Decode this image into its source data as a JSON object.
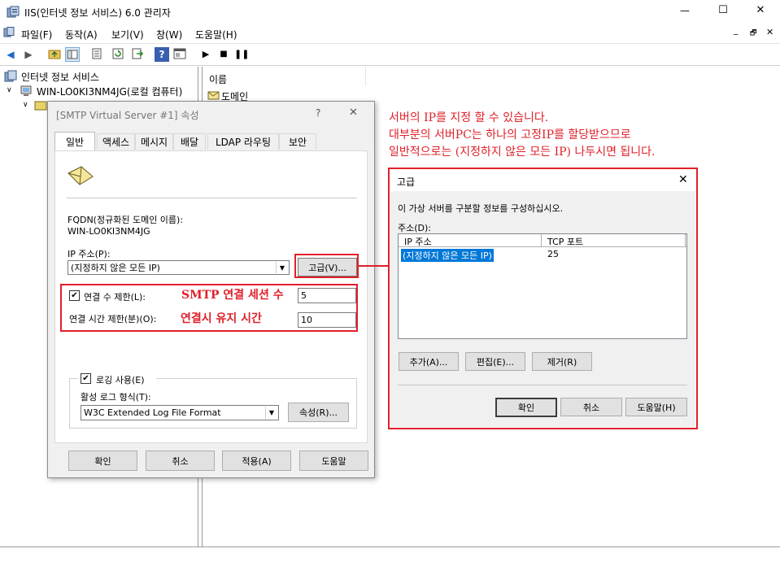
{
  "window": {
    "title": "IIS(인터넷 정보 서비스) 6.0 관리자",
    "minimize": "—",
    "maximize": "☐",
    "close": "✕"
  },
  "menu": {
    "items": [
      "파일(F)",
      "동작(A)",
      "보기(V)",
      "창(W)",
      "도움말(H)"
    ],
    "mdi_controls": [
      "_",
      "🗗",
      "✕"
    ]
  },
  "toolbar": {
    "icons": [
      "back-icon",
      "forward-icon",
      "up-folder-icon",
      "show-tree-icon",
      "properties-icon",
      "refresh-icon",
      "export-icon",
      "help-icon",
      "console-icon",
      "play-icon",
      "stop-icon",
      "pause-icon"
    ]
  },
  "tree": {
    "root": "인터넷 정보 서비스",
    "server": "WIN-LO0KI3NM4JG(로컬 컴퓨터)"
  },
  "right_pane": {
    "column_header": "이름",
    "items": [
      "도메인"
    ]
  },
  "props_dialog": {
    "title": "[SMTP Virtual Server #1] 속성",
    "help": "?",
    "close": "✕",
    "tabs": [
      "일반",
      "액세스",
      "메시지",
      "배달",
      "LDAP 라우팅",
      "보안"
    ],
    "fqdn_label": "FQDN(정규화된 도메인 이름):",
    "fqdn_value": "WIN-LO0KI3NM4JG",
    "ip_label": "IP 주소(P):",
    "ip_value": "(지정하지 않은 모든 IP)",
    "advanced_button": "고급(V)...",
    "limit_connections_label": "연결 수 제한(L):",
    "limit_connections_value": "5",
    "timeout_label": "연결 시간 제한(분)(O):",
    "timeout_value": "10",
    "logging_label": "로깅 사용(E)",
    "log_format_label": "활성 로그 형식(T):",
    "log_format_value": "W3C Extended Log File Format",
    "log_props_button": "속성(R)...",
    "ok": "확인",
    "cancel": "취소",
    "apply": "적용(A)",
    "help_button": "도움말"
  },
  "annotations": {
    "smtp_sessions": "SMTP 연결 세션 수",
    "keep_alive": "연결시 유지 시간",
    "top_note_line1": "서버의 IP를 지정 할 수 있습니다.",
    "top_note_line2": "대부분의 서버PC는 하나의 고정IP를 할당받으므로",
    "top_note_line3": "일반적으로는 (지정하지 않은 모든 IP) 나두시면 됩니다."
  },
  "advanced_dialog": {
    "title": "고급",
    "close": "✕",
    "description": "이 가상 서버를 구분할 정보를 구성하십시오.",
    "address_label": "주소(D):",
    "col_ip": "IP 주소",
    "col_port": "TCP 포트",
    "rows": [
      {
        "ip": "(지정하지 않은 모든 IP)",
        "port": "25"
      }
    ],
    "add": "추가(A)...",
    "edit": "편집(E)...",
    "remove": "제거(R)",
    "ok": "확인",
    "cancel": "취소",
    "help": "도움말(H)"
  },
  "colors": {
    "accent_red": "#e0202a",
    "selection_blue": "#0078d7"
  }
}
